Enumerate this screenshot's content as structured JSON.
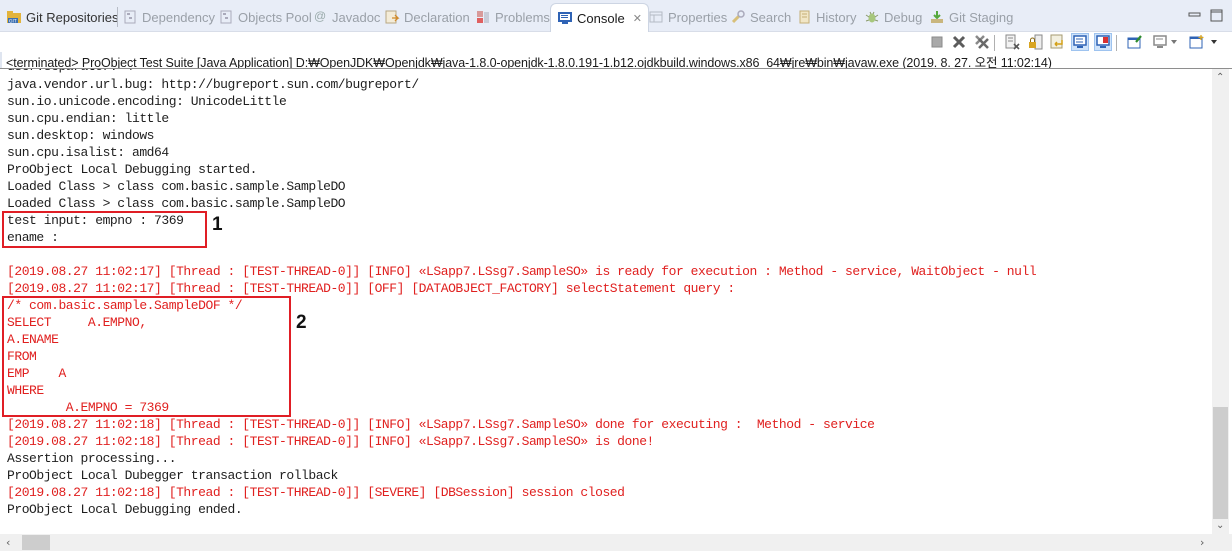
{
  "tabs": [
    {
      "label": "Git Repositories",
      "icon": "git-repositories-icon",
      "active": false
    },
    {
      "label": "Dependency",
      "icon": "dependency-icon",
      "active": false
    },
    {
      "label": "Objects Pool",
      "icon": "objects-pool-icon",
      "active": false
    },
    {
      "label": "Javadoc",
      "icon": "javadoc-icon",
      "active": false
    },
    {
      "label": "Declaration",
      "icon": "declaration-icon",
      "active": false
    },
    {
      "label": "Problems",
      "icon": "problems-icon",
      "active": false
    },
    {
      "label": "Console",
      "icon": "console-icon",
      "active": true,
      "close": "✕"
    },
    {
      "label": "Properties",
      "icon": "properties-icon",
      "active": false
    },
    {
      "label": "Search",
      "icon": "search-icon",
      "active": false
    },
    {
      "label": "History",
      "icon": "history-icon",
      "active": false
    },
    {
      "label": "Debug",
      "icon": "debug-icon",
      "active": false
    },
    {
      "label": "Git Staging",
      "icon": "git-staging-icon",
      "active": false
    }
  ],
  "toolbar": {
    "buttons": [
      {
        "name": "terminate",
        "icon": "stop-icon"
      },
      {
        "name": "remove-launch",
        "icon": "remove-launch-icon"
      },
      {
        "name": "remove-all-terminated",
        "icon": "remove-all-terminated-icon"
      },
      {
        "name": "clear-console",
        "icon": "clear-console-icon"
      },
      {
        "name": "scroll-lock",
        "icon": "scroll-lock-icon"
      },
      {
        "name": "word-wrap",
        "icon": "word-wrap-icon"
      },
      {
        "name": "show-console-on-stdout",
        "icon": "show-stdout-icon",
        "pressed": true
      },
      {
        "name": "show-console-on-stderr",
        "icon": "show-stderr-icon",
        "pressed": true
      },
      {
        "name": "pin-console",
        "icon": "pin-console-icon"
      },
      {
        "name": "display-selected-console",
        "icon": "display-console-icon",
        "dropdown": true
      },
      {
        "name": "open-console",
        "icon": "open-console-icon",
        "dropdown": true
      }
    ]
  },
  "process_title": "<terminated> ProObject Test Suite [Java Application] D:₩OpenJDK₩Openjdk₩java-1.8.0-openjdk-1.8.0.191-1.b12.ojdkbuild.windows.x86_64₩jre₩bin₩javaw.exe (2019. 8. 27. 오전 11:02:14)",
  "console_lines": [
    {
      "text": "java.vendor.url.bug: http://bugreport.sun.com/bugreport/",
      "type": "out"
    },
    {
      "text": "sun.io.unicode.encoding: UnicodeLittle",
      "type": "out"
    },
    {
      "text": "sun.cpu.endian: little",
      "type": "out"
    },
    {
      "text": "sun.desktop: windows",
      "type": "out"
    },
    {
      "text": "sun.cpu.isalist: amd64",
      "type": "out"
    },
    {
      "text": "ProObject Local Debugging started.",
      "type": "out"
    },
    {
      "text": "Loaded Class > class com.basic.sample.SampleDO",
      "type": "out"
    },
    {
      "text": "Loaded Class > class com.basic.sample.SampleDO",
      "type": "out"
    },
    {
      "text": "test input: empno : 7369",
      "type": "out"
    },
    {
      "text": "ename :",
      "type": "out"
    },
    {
      "text": "",
      "type": "out"
    },
    {
      "text": "[2019.08.27 11:02:17] [Thread : [TEST-THREAD-0]] [INFO] «LSapp7.LSsg7.SampleSO» is ready for execution : Method - service, WaitObject - null",
      "type": "err"
    },
    {
      "text": "[2019.08.27 11:02:17] [Thread : [TEST-THREAD-0]] [OFF] [DATAOBJECT_FACTORY] selectStatement query :",
      "type": "err"
    },
    {
      "text": "/* com.basic.sample.SampleDOF */",
      "type": "err"
    },
    {
      "text": "SELECT     A.EMPNO,",
      "type": "err"
    },
    {
      "text": "A.ENAME",
      "type": "err"
    },
    {
      "text": "FROM",
      "type": "err"
    },
    {
      "text": "EMP    A",
      "type": "err"
    },
    {
      "text": "WHERE",
      "type": "err"
    },
    {
      "text": "        A.EMPNO = 7369",
      "type": "err"
    },
    {
      "text": "[2019.08.27 11:02:18] [Thread : [TEST-THREAD-0]] [INFO] «LSapp7.LSsg7.SampleSO» done for executing :  Method - service",
      "type": "err"
    },
    {
      "text": "[2019.08.27 11:02:18] [Thread : [TEST-THREAD-0]] [INFO] «LSapp7.LSsg7.SampleSO» is done!",
      "type": "err"
    },
    {
      "text": "Assertion processing...",
      "type": "out"
    },
    {
      "text": "ProObject Local Dubegger transaction rollback",
      "type": "out"
    },
    {
      "text": "[2019.08.27 11:02:18] [Thread : [TEST-THREAD-0]] [SEVERE] [DBSession] session closed",
      "type": "err"
    },
    {
      "text": "ProObject Local Debugging ended.",
      "type": "out"
    }
  ],
  "annotations": [
    {
      "label": "1"
    },
    {
      "label": "2"
    }
  ],
  "colors": {
    "stderr": "#e0201f",
    "stdout": "#1e1e1e",
    "annotation_box": "#e01e25",
    "tab_bar_bg": "#e8edf7"
  },
  "scroll": {
    "vertical_position_fraction": 0.78,
    "horizontal_position_fraction": 0.0
  }
}
